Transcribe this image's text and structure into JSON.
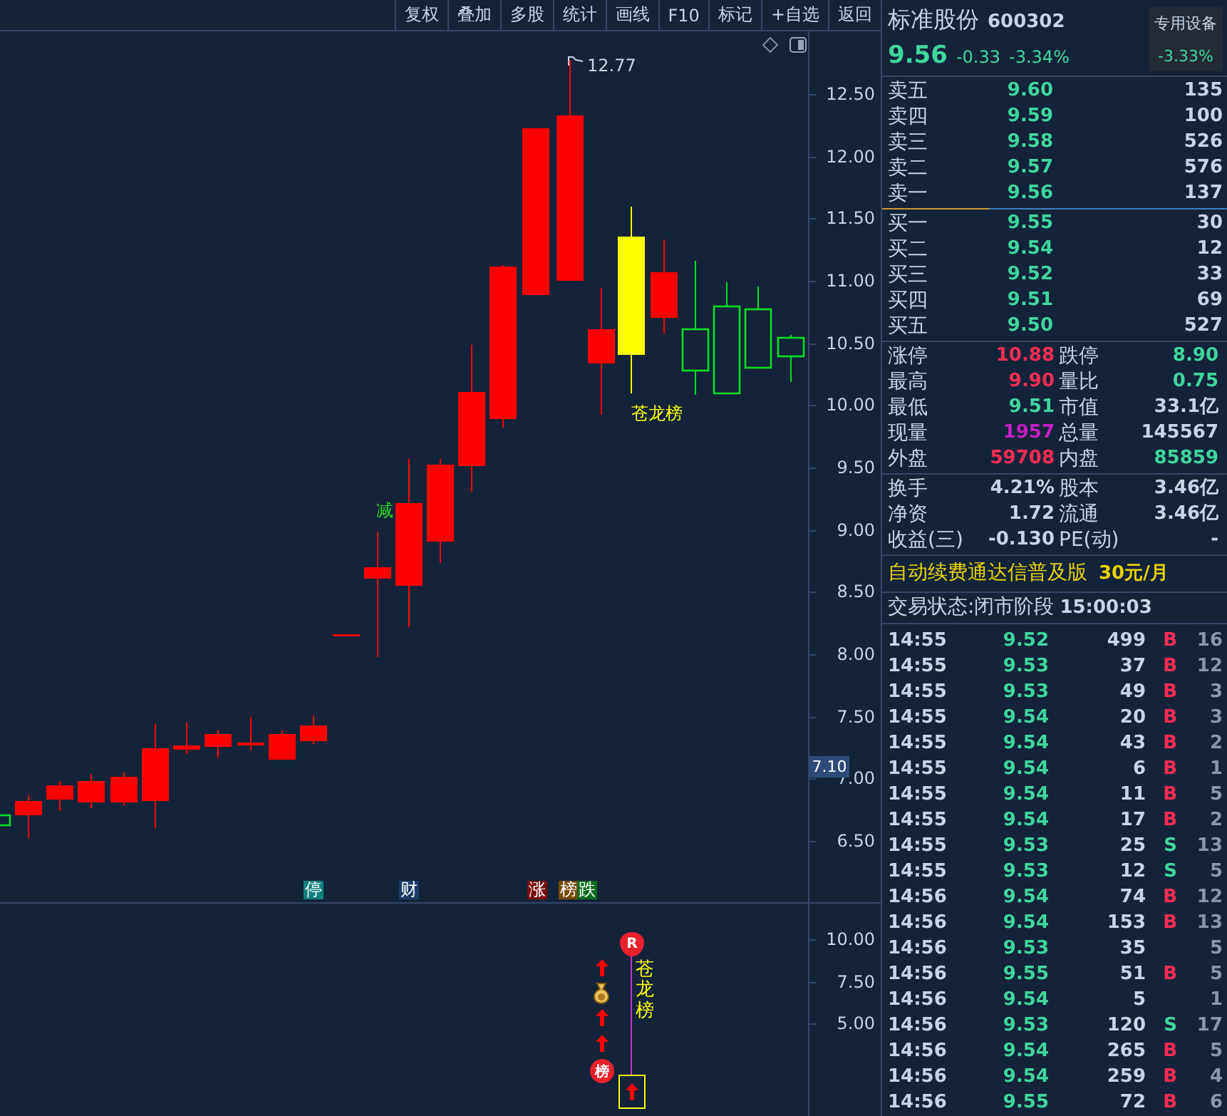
{
  "toolbar": {
    "buttons": [
      "复权",
      "叠加",
      "多股",
      "统计",
      "画线",
      "F10",
      "标记",
      "+自选",
      "返回"
    ]
  },
  "main_chart": {
    "y_ticks": [
      "12.50",
      "12.00",
      "11.50",
      "11.00",
      "10.50",
      "10.00",
      "9.50",
      "9.00",
      "8.50",
      "8.00",
      "7.50",
      "7.00",
      "6.50"
    ],
    "current_price_label": "7.10",
    "high_label": "12.77",
    "annotation": "苍龙榜",
    "reduce_mark": "减",
    "markers": [
      {
        "text": "停",
        "color": "#0f7f7f"
      },
      {
        "text": "财",
        "color": "#1b3d6b"
      },
      {
        "text": "涨",
        "color": "#7a0c0c"
      },
      {
        "text": "榜",
        "color": "#7a4a0a"
      },
      {
        "text": "跌",
        "color": "#0b6b1c"
      }
    ]
  },
  "indicator": {
    "y_ticks": [
      "10.00",
      "7.50",
      "5.00"
    ],
    "top_badge": "R",
    "rank_badge": "榜",
    "vertical_label": "苍龙榜"
  },
  "quote": {
    "name": "标准股份",
    "code": "600302",
    "price": "9.56",
    "change": "-0.33",
    "change_pct": "-3.34%",
    "sector": "专用设备",
    "sector_change": "-3.33%"
  },
  "asks": [
    {
      "label": "卖五",
      "price": "9.60",
      "volume": "135"
    },
    {
      "label": "卖四",
      "price": "9.59",
      "volume": "100"
    },
    {
      "label": "卖三",
      "price": "9.58",
      "volume": "526"
    },
    {
      "label": "卖二",
      "price": "9.57",
      "volume": "576"
    },
    {
      "label": "卖一",
      "price": "9.56",
      "volume": "137"
    }
  ],
  "bids": [
    {
      "label": "买一",
      "price": "9.55",
      "volume": "30"
    },
    {
      "label": "买二",
      "price": "9.54",
      "volume": "12"
    },
    {
      "label": "买三",
      "price": "9.52",
      "volume": "33"
    },
    {
      "label": "买四",
      "price": "9.51",
      "volume": "69"
    },
    {
      "label": "买五",
      "price": "9.50",
      "volume": "527"
    }
  ],
  "stats": [
    {
      "label": "涨停",
      "value": "10.88",
      "color": "#ff2d55"
    },
    {
      "label": "跌停",
      "value": "8.90",
      "color": "#3fd69b"
    },
    {
      "label": "最高",
      "value": "9.90",
      "color": "#ff2d55"
    },
    {
      "label": "量比",
      "value": "0.75",
      "color": "#3fd69b"
    },
    {
      "label": "最低",
      "value": "9.51",
      "color": "#3fd69b"
    },
    {
      "label": "市值",
      "value": "33.1亿",
      "color": "#c8d4e6"
    },
    {
      "label": "现量",
      "value": "1957",
      "color": "#c21fc2"
    },
    {
      "label": "总量",
      "value": "145567",
      "color": "#c8d4e6"
    },
    {
      "label": "外盘",
      "value": "59708",
      "color": "#ff2d55"
    },
    {
      "label": "内盘",
      "value": "85859",
      "color": "#3fd69b"
    }
  ],
  "fundamentals": [
    {
      "label": "换手",
      "value": "4.21%"
    },
    {
      "label": "股本",
      "value": "3.46亿"
    },
    {
      "label": "净资",
      "value": "1.72"
    },
    {
      "label": "流通",
      "value": "3.46亿"
    },
    {
      "label": "收益(三)",
      "value": "-0.130"
    },
    {
      "label": "PE(动)",
      "value": "-"
    }
  ],
  "ad": {
    "text": "自动续费通达信普及版",
    "price": "30元/月"
  },
  "status": {
    "label": "交易状态:闭市阶段",
    "time": "15:00:03"
  },
  "trades": [
    {
      "time": "14:55",
      "price": "9.52",
      "volume": "499",
      "side": "B",
      "kind": "buy",
      "count": "16"
    },
    {
      "time": "14:55",
      "price": "9.53",
      "volume": "37",
      "side": "B",
      "kind": "buy",
      "count": "12"
    },
    {
      "time": "14:55",
      "price": "9.53",
      "volume": "49",
      "side": "B",
      "kind": "buy",
      "count": "3"
    },
    {
      "time": "14:55",
      "price": "9.54",
      "volume": "20",
      "side": "B",
      "kind": "buy",
      "count": "3"
    },
    {
      "time": "14:55",
      "price": "9.54",
      "volume": "43",
      "side": "B",
      "kind": "buy",
      "count": "2"
    },
    {
      "time": "14:55",
      "price": "9.54",
      "volume": "6",
      "side": "B",
      "kind": "buy",
      "count": "1"
    },
    {
      "time": "14:55",
      "price": "9.54",
      "volume": "11",
      "side": "B",
      "kind": "buy",
      "count": "5"
    },
    {
      "time": "14:55",
      "price": "9.54",
      "volume": "17",
      "side": "B",
      "kind": "buy",
      "count": "2"
    },
    {
      "time": "14:55",
      "price": "9.53",
      "volume": "25",
      "side": "S",
      "kind": "sell",
      "count": "13"
    },
    {
      "time": "14:55",
      "price": "9.53",
      "volume": "12",
      "side": "S",
      "kind": "sell",
      "count": "5"
    },
    {
      "time": "14:56",
      "price": "9.54",
      "volume": "74",
      "side": "B",
      "kind": "buy",
      "count": "12"
    },
    {
      "time": "14:56",
      "price": "9.54",
      "volume": "153",
      "side": "B",
      "kind": "buy",
      "count": "13"
    },
    {
      "time": "14:56",
      "price": "9.53",
      "volume": "35",
      "count": "5"
    },
    {
      "time": "14:56",
      "price": "9.55",
      "volume": "51",
      "side": "B",
      "kind": "buy",
      "count": "5"
    },
    {
      "time": "14:56",
      "price": "9.54",
      "volume": "5",
      "count": "1"
    },
    {
      "time": "14:56",
      "price": "9.53",
      "volume": "120",
      "side": "S",
      "kind": "sell",
      "count": "17"
    },
    {
      "time": "14:56",
      "price": "9.54",
      "volume": "265",
      "side": "B",
      "kind": "buy",
      "count": "5"
    },
    {
      "time": "14:56",
      "price": "9.54",
      "volume": "259",
      "side": "B",
      "kind": "buy",
      "count": "4"
    },
    {
      "time": "14:56",
      "price": "9.55",
      "volume": "72",
      "side": "B",
      "kind": "buy",
      "count": "6"
    }
  ]
}
